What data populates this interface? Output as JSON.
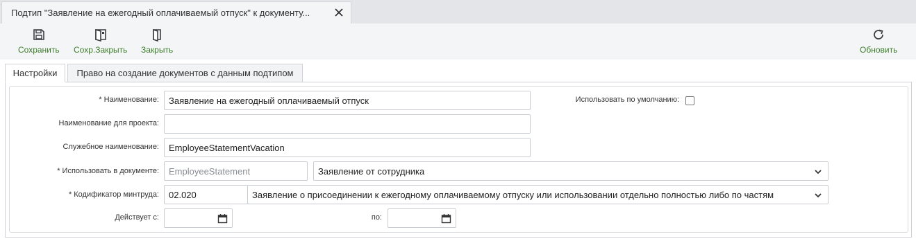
{
  "document_tab": {
    "title": "Подтип \"Заявление на ежегодный оплачиваемый отпуск\" к документу..."
  },
  "toolbar": {
    "save_label": "Сохранить",
    "save_close_label": "Сохр.Закрыть",
    "close_label": "Закрыть",
    "refresh_label": "Обновить"
  },
  "form_tabs": [
    {
      "label": "Настройки",
      "active": true
    },
    {
      "label": "Право на создание документов с данным подтипом",
      "active": false
    }
  ],
  "form": {
    "name_label": "* Наименование:",
    "name_value": "Заявление на ежегодный оплачиваемый отпуск",
    "default_label": "Использовать по умолчанию:",
    "default_checked": false,
    "project_name_label": "Наименование для проекта:",
    "project_name_value": "",
    "service_name_label": "Служебное наименование:",
    "service_name_value": "EmployeeStatementVacation",
    "use_in_doc_label": "* Использовать в документе:",
    "use_in_doc_code": "EmployeeStatement",
    "use_in_doc_value": "Заявление от сотрудника",
    "codifier_label": "* Кодификатор минтруда:",
    "codifier_code": "02.020",
    "codifier_value": "Заявление о присоединении к ежегодному оплачиваемому отпуску или использовании отдельно полностью либо по частям",
    "valid_from_label": "Действует с:",
    "valid_from_value": "",
    "valid_to_label": "по:",
    "valid_to_value": ""
  },
  "colors": {
    "accent_green": "#3f7d2c",
    "icon_dark": "#3a3d42"
  }
}
